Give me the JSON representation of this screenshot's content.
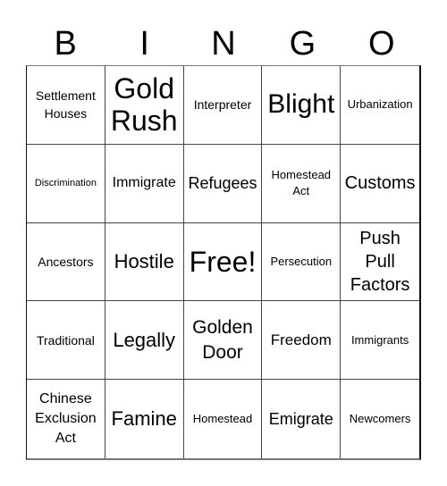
{
  "header": {
    "letters": [
      "B",
      "I",
      "N",
      "G",
      "O"
    ]
  },
  "cells": [
    [
      "Settlement Houses",
      "Gold Rush",
      "Interpreter",
      "Blight",
      "Urbanization"
    ],
    [
      "Discrimination",
      "Immigrate",
      "Refugees",
      "Homestead Act",
      "Customs"
    ],
    [
      "Ancestors",
      "Hostile",
      "Free!",
      "Persecution",
      "Push Pull Factors"
    ],
    [
      "Traditional",
      "Legally",
      "Golden Door",
      "Freedom",
      "Immigrants"
    ],
    [
      "Chinese Exclusion Act",
      "Famine",
      "Homestead",
      "Emigrate",
      "Newcomers"
    ]
  ],
  "cell_lines": [
    [
      "Settlement\nHouses",
      "Gold\nRush",
      "Interpreter",
      "Blight",
      "Urbanization"
    ],
    [
      "Discrimination",
      "Immigrate",
      "Refugees",
      "Homestead\nAct",
      "Customs"
    ],
    [
      "Ancestors",
      "Hostile",
      "Free!",
      "Persecution",
      "Push\nPull\nFactors"
    ],
    [
      "Traditional",
      "Legally",
      "Golden\nDoor",
      "Freedom",
      "Immigrants"
    ],
    [
      "Chinese\nExclusion\nAct",
      "Famine",
      "Homestead",
      "Emigrate",
      "Newcomers"
    ]
  ],
  "free_space": "Free!"
}
